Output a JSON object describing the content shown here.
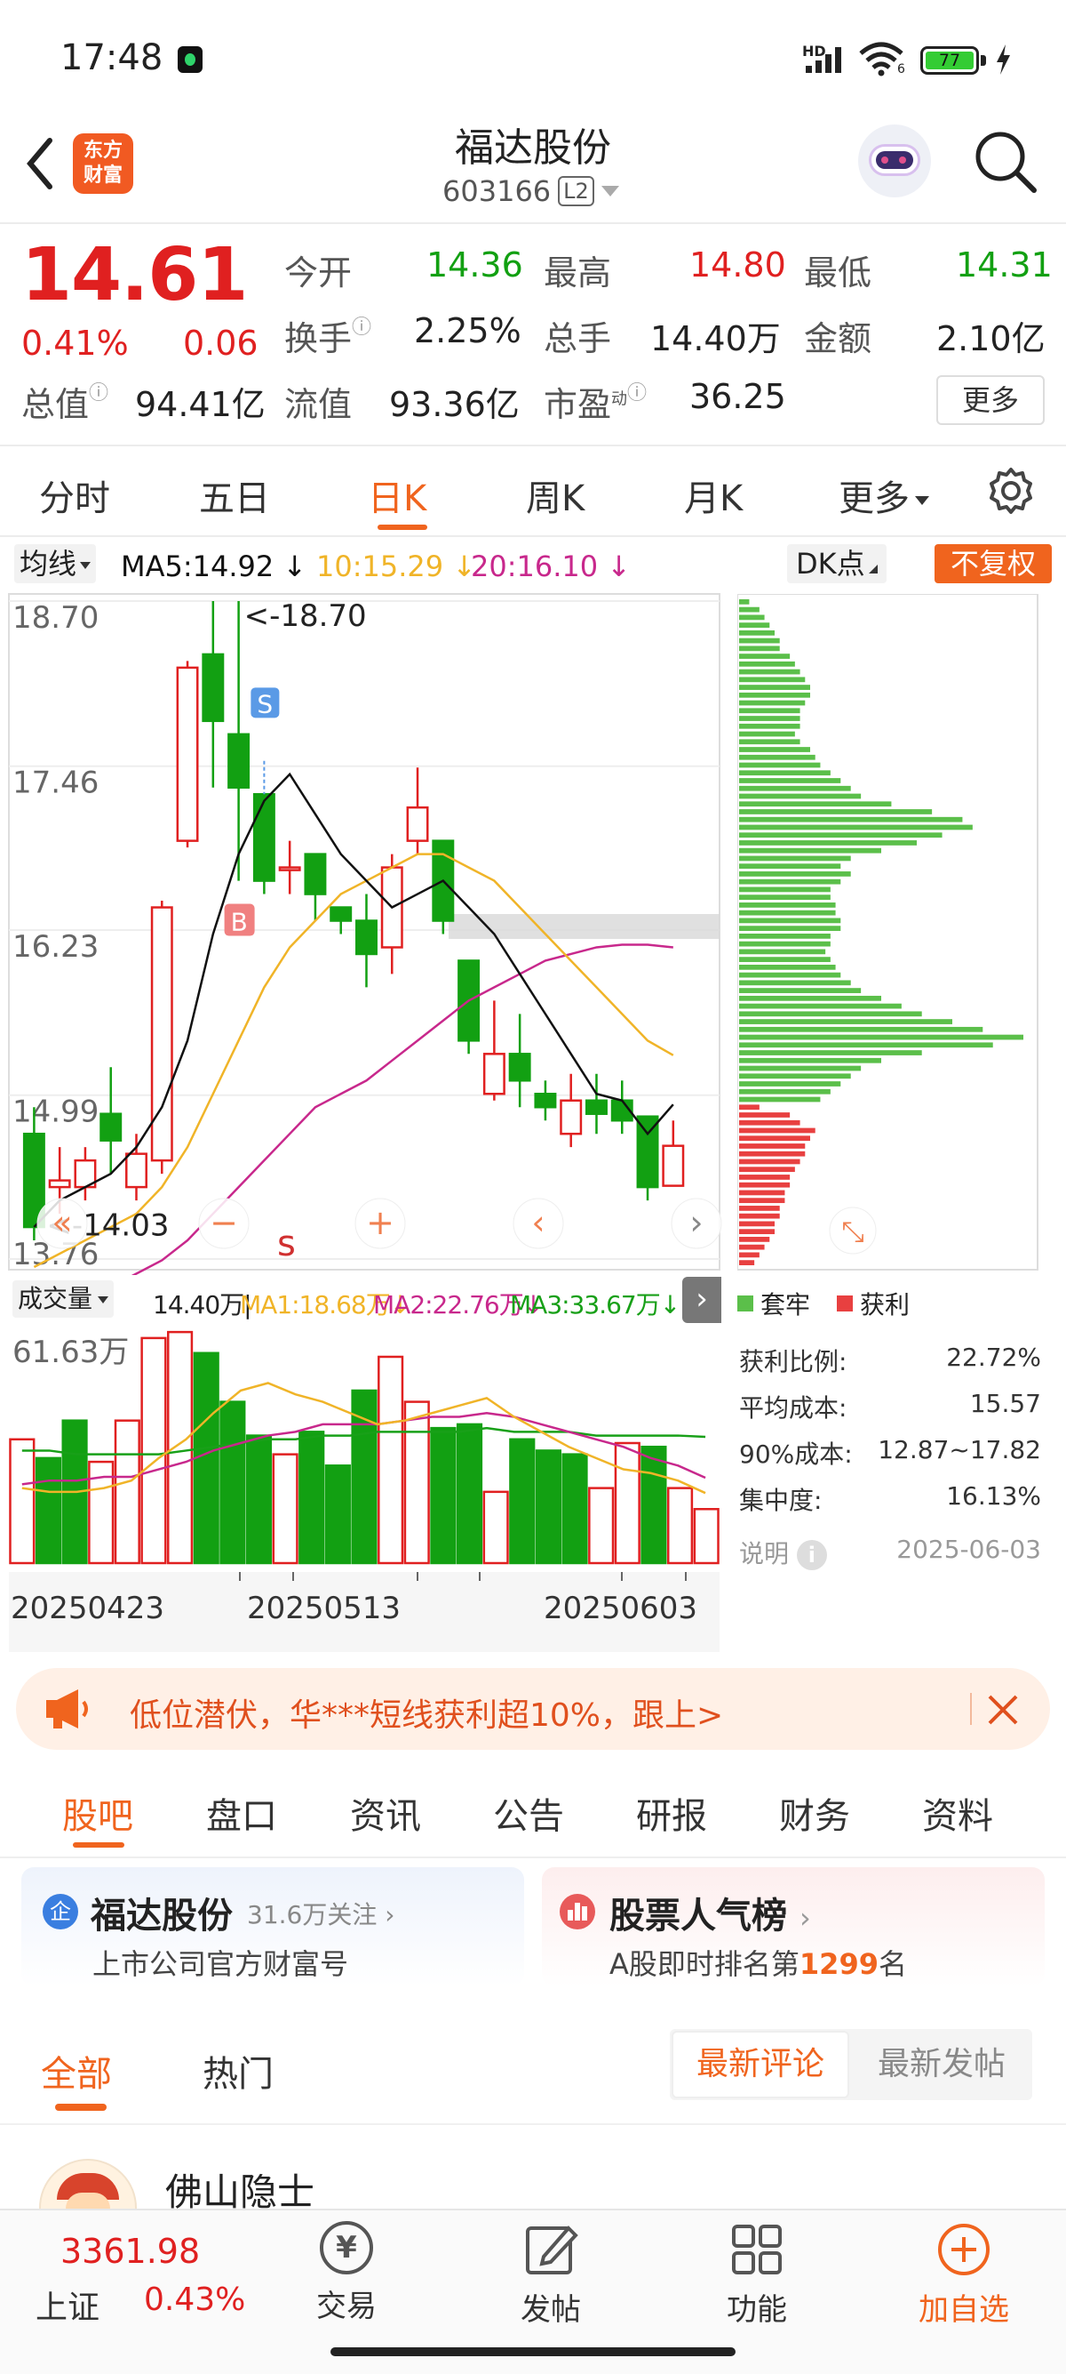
{
  "status": {
    "time": "17:48",
    "battery": "77",
    "hd": "HD",
    "wifi_sub": "6"
  },
  "header": {
    "badge": "东方财富",
    "name": "福达股份",
    "code": "603166",
    "l2": "L2"
  },
  "quote": {
    "price": "14.61",
    "pct": "0.41%",
    "chg": "0.06",
    "row1": [
      {
        "l": "今开",
        "v": "14.36"
      },
      {
        "l": "最高",
        "v": "14.80"
      },
      {
        "l": "最低",
        "v": "14.31"
      }
    ],
    "row2": [
      {
        "l": "换手",
        "v": "2.25%"
      },
      {
        "l": "总手",
        "v": "14.40万"
      },
      {
        "l": "金额",
        "v": "2.10亿"
      }
    ],
    "row3": [
      {
        "l": "总值",
        "v": "94.41亿"
      },
      {
        "l": "流值",
        "v": "93.36亿"
      },
      {
        "l": "市盈",
        "sup": "动",
        "v": "36.25"
      }
    ],
    "more": "更多"
  },
  "period_tabs": [
    "分时",
    "五日",
    "日K",
    "周K",
    "月K",
    "更多"
  ],
  "ma_bar": {
    "select": "均线",
    "ma5": "MA5:14.92",
    "ma10": "10:15.29",
    "ma20": "20:16.10",
    "dk": "DK点",
    "fq": "不复权"
  },
  "colors": {
    "up": "#e02020",
    "down": "#12a012",
    "accent": "#f0641e",
    "ma5": "#111111",
    "ma10": "#f0b428",
    "ma20": "#c8288c"
  },
  "chart_data": [
    {
      "type": "candlestick",
      "title": "日K",
      "y_ticks": [
        "18.70",
        "17.46",
        "16.23",
        "14.99",
        "13.76"
      ],
      "ylim": [
        13.76,
        18.7
      ],
      "annotations": {
        "high": "<-18.70",
        "low": "<-14.03",
        "buy": "B",
        "sell": "S",
        "s_mark": "s"
      },
      "candles": [
        {
          "o": 14.7,
          "c": 14.0,
          "h": 14.9,
          "l": 13.9
        },
        {
          "o": 14.3,
          "c": 14.35,
          "h": 14.6,
          "l": 14.1
        },
        {
          "o": 14.3,
          "c": 14.5,
          "h": 14.6,
          "l": 14.2
        },
        {
          "o": 14.85,
          "c": 14.65,
          "h": 15.2,
          "l": 14.4
        },
        {
          "o": 14.3,
          "c": 14.55,
          "h": 14.7,
          "l": 14.2
        },
        {
          "o": 14.5,
          "c": 16.4,
          "h": 16.45,
          "l": 14.4
        },
        {
          "o": 16.9,
          "c": 18.2,
          "h": 18.25,
          "l": 16.85
        },
        {
          "o": 18.3,
          "c": 17.8,
          "h": 18.7,
          "l": 17.3
        },
        {
          "o": 17.7,
          "c": 17.3,
          "h": 18.7,
          "l": 16.6
        },
        {
          "o": 17.25,
          "c": 16.6,
          "h": 17.25,
          "l": 16.5
        },
        {
          "o": 16.7,
          "c": 16.7,
          "h": 16.9,
          "l": 16.5
        },
        {
          "o": 16.8,
          "c": 16.5,
          "h": 16.8,
          "l": 16.3
        },
        {
          "o": 16.4,
          "c": 16.3,
          "h": 16.4,
          "l": 16.2
        },
        {
          "o": 16.3,
          "c": 16.05,
          "h": 16.5,
          "l": 15.8
        },
        {
          "o": 16.1,
          "c": 16.7,
          "h": 16.8,
          "l": 15.9
        },
        {
          "o": 16.9,
          "c": 17.15,
          "h": 17.45,
          "l": 16.8
        },
        {
          "o": 16.9,
          "c": 16.3,
          "h": 16.9,
          "l": 16.2
        },
        {
          "o": 16.0,
          "c": 15.4,
          "h": 16.0,
          "l": 15.3
        },
        {
          "o": 15.0,
          "c": 15.3,
          "h": 15.7,
          "l": 14.95
        },
        {
          "o": 15.3,
          "c": 15.1,
          "h": 15.6,
          "l": 14.9
        },
        {
          "o": 15.0,
          "c": 14.9,
          "h": 15.1,
          "l": 14.8
        },
        {
          "o": 14.7,
          "c": 14.95,
          "h": 15.15,
          "l": 14.6
        },
        {
          "o": 14.95,
          "c": 14.85,
          "h": 15.15,
          "l": 14.7
        },
        {
          "o": 14.95,
          "c": 14.8,
          "h": 15.1,
          "l": 14.7
        },
        {
          "o": 14.83,
          "c": 14.3,
          "h": 14.83,
          "l": 14.2
        },
        {
          "o": 14.31,
          "c": 14.61,
          "h": 14.8,
          "l": 14.31
        }
      ],
      "ma5": [
        14.0,
        14.2,
        14.3,
        14.4,
        14.6,
        14.9,
        15.4,
        16.2,
        16.8,
        17.2,
        17.4,
        17.1,
        16.8,
        16.6,
        16.4,
        16.5,
        16.6,
        16.4,
        16.2,
        15.9,
        15.6,
        15.3,
        15.0,
        14.95,
        14.7,
        14.92
      ],
      "ma10": [
        13.7,
        13.8,
        13.9,
        14.0,
        14.1,
        14.3,
        14.6,
        15.0,
        15.4,
        15.8,
        16.1,
        16.3,
        16.5,
        16.6,
        16.7,
        16.8,
        16.8,
        16.7,
        16.6,
        16.4,
        16.2,
        16.0,
        15.8,
        15.6,
        15.4,
        15.29
      ],
      "ma20": [
        13.3,
        13.35,
        13.45,
        13.55,
        13.65,
        13.75,
        13.9,
        14.1,
        14.3,
        14.5,
        14.7,
        14.9,
        15.0,
        15.1,
        15.25,
        15.4,
        15.55,
        15.7,
        15.8,
        15.9,
        16.0,
        16.05,
        16.1,
        16.12,
        16.12,
        16.1
      ]
    },
    {
      "type": "bar",
      "title": "成交量",
      "header": {
        "select": "成交量",
        "vol": "14.40万",
        "ma1": "MA1:18.68万",
        "ma2": "MA2:22.76万",
        "ma3": "MA3:33.67万"
      },
      "y_max_label": "61.63万",
      "dates": [
        "20250423",
        "20250513",
        "20250603"
      ],
      "values": [
        33,
        28,
        38,
        27,
        38,
        60,
        61.6,
        56,
        43,
        34,
        29,
        35,
        26,
        46,
        55,
        43,
        36,
        37,
        19,
        33,
        30,
        29,
        20,
        32,
        31,
        20,
        14.4
      ],
      "up": [
        true,
        false,
        false,
        true,
        true,
        true,
        true,
        false,
        false,
        false,
        true,
        false,
        false,
        false,
        true,
        true,
        false,
        false,
        true,
        false,
        false,
        false,
        true,
        true,
        false,
        true
      ],
      "ma_a": [
        20,
        19,
        19,
        20,
        22,
        28,
        33,
        40,
        46,
        48,
        45,
        43,
        40,
        37,
        38,
        40,
        42,
        44,
        39,
        35,
        31,
        28,
        25,
        24,
        22,
        18.68
      ],
      "ma_b": [
        21,
        22,
        22,
        23,
        23,
        25,
        27,
        30,
        32,
        34,
        35,
        37,
        37,
        37,
        38,
        39,
        39,
        40,
        39,
        37,
        35,
        33,
        31,
        28,
        26,
        22.76
      ],
      "ma_c": [
        30,
        30,
        29,
        29,
        29,
        29,
        30,
        31,
        32,
        33,
        33,
        34,
        34,
        35,
        35,
        35,
        35,
        36,
        35,
        35,
        35,
        34,
        34,
        34,
        34,
        33.67
      ]
    },
    {
      "type": "bar",
      "title": "筹码分布",
      "orientation": "horizontal",
      "green": [
        2,
        4,
        5,
        6,
        7,
        8,
        8,
        10,
        11,
        12,
        13,
        14,
        14,
        13,
        12,
        12,
        12,
        11,
        12,
        14,
        15,
        16,
        18,
        20,
        22,
        24,
        30,
        38,
        44,
        46,
        40,
        35,
        28,
        22,
        20,
        22,
        20,
        18,
        18,
        19,
        19,
        20,
        20,
        18,
        18,
        17,
        18,
        19,
        20,
        22,
        24,
        28,
        32,
        36,
        42,
        48,
        56,
        50,
        36,
        28,
        24,
        22,
        20,
        18,
        16
      ],
      "red": [
        4,
        10,
        12,
        15,
        14,
        13,
        13,
        12,
        11,
        10,
        10,
        9,
        9,
        8,
        8,
        7,
        7,
        6,
        5,
        4,
        3
      ],
      "legend": {
        "trapped": "套牢",
        "profit": "获利"
      },
      "stats": [
        {
          "l": "获利比例:",
          "v": "22.72%"
        },
        {
          "l": "平均成本:",
          "v": "15.57"
        },
        {
          "l": "90%成本:",
          "v": "12.87~17.82"
        },
        {
          "l": "集中度:",
          "v": "16.13%"
        }
      ],
      "note": "说明",
      "date": "2025-06-03"
    }
  ],
  "banner": {
    "text": "低位潜伏，华***短线获利超10%，跟上>"
  },
  "info_tabs": [
    "股吧",
    "盘口",
    "资讯",
    "公告",
    "研报",
    "财务",
    "资料"
  ],
  "cards": {
    "left_name": "福达股份",
    "left_follow": "31.6万关注",
    "left_sub": "上市公司官方财富号",
    "right_name": "股票人气榜",
    "right_pre": "A股即时排名第",
    "right_rank": "1299",
    "right_suf": "名"
  },
  "filter": {
    "all": "全部",
    "hot": "热门",
    "latest_comment": "最新评论",
    "latest_post": "最新发帖"
  },
  "post": {
    "author": "佛山隐士"
  },
  "bottom": {
    "index_value": "3361.98",
    "index_name": "上证",
    "index_pct": "0.43%",
    "trade": "交易",
    "post": "发帖",
    "func": "功能",
    "add": "加自选"
  }
}
